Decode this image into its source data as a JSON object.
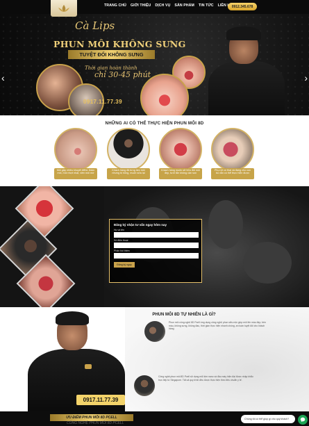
{
  "nav": {
    "items": [
      "TRANG CHỦ",
      "GIỚI THIỆU",
      "DỊCH VỤ",
      "SẢN PHẨM",
      "TIN TỨC",
      "LIÊN HỆ"
    ],
    "phone": "0912.345.678"
  },
  "hero": {
    "brand": "Cà Lips",
    "headline": "PHUN MÔI KHÔNG SƯNG",
    "ribbon": "TUYỆT ĐỐI KHÔNG SƯNG",
    "sub_line1": "Thời gian hoàn thành",
    "sub_line2": "chỉ 30-45 phút",
    "hotline": "0917.11.77.39",
    "arrow_left": "‹",
    "arrow_right": "›"
  },
  "who": {
    "title": "NHỮNG AI CÓ THỂ THỰC HIỆN PHUN MÔI 8D",
    "cards": [
      {
        "caption": "Môi gặp nhiều khuyết điểm: thâm môi, môi nhợt nhạt, viền môi mờ"
      },
      {
        "caption": "Khách hàng đã từng làm môi nhưng bị hỏng, muốn sửa lại"
      },
      {
        "caption": "Khách hàng muốn sở hữu đôi môi đẹp, tươi tắn không cần son"
      },
      {
        "caption": "Phụ nữ có thai và đang cho con bú vẫn có thể thực hiện được"
      }
    ]
  },
  "form": {
    "title": "Đăng ký nhận tư vấn ngay hôm nay",
    "label_name": "Họ và tên",
    "label_phone": "Số điện thoại",
    "label_note": "Phản hồi thêm",
    "submit": "Đăng ký ngay"
  },
  "what": {
    "title": "PHUN MÔI 8D TỰ NHIÊN LÀ GÌ?",
    "para1": "Phun môi công nghệ 8D Pcell ứng dụng công nghệ phun siêu mịn giúp môi lên màu đẹp, bền màu, không sưng, không đau, thời gian thực hiện nhanh chóng, an toàn tuyệt đối cho khách hàng.",
    "para2": "Công nghệ phun môi 8D Pcell sử dụng mũi kim nano và đầu máy hiện đại được nhập khẩu trực tiếp từ Singapore. Tất cả quy trình đều được thực hiện theo tiêu chuẩn y tế."
  },
  "man_phone": "0917.11.77.39",
  "bottom": {
    "ribbon": "ƯU ĐIỂM PHUN MÔI 8D PCELL",
    "faint": "CÔNG NGHỆ PHUN MÔI 8D PCELL"
  },
  "chat": {
    "label": "Chúng tôi có thể giúp gì cho quý khách?"
  }
}
